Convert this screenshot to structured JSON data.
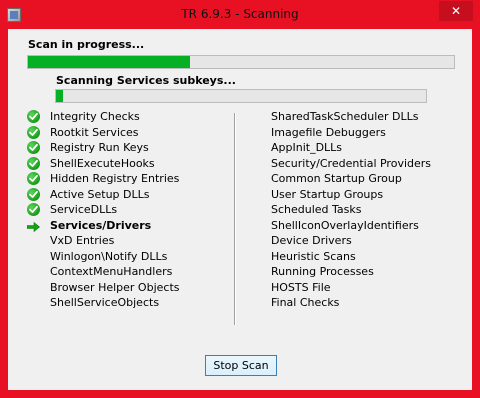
{
  "window": {
    "title": "TR 6.9.3 - Scanning",
    "close_label": "✕",
    "accent_color": "#e81123"
  },
  "scan": {
    "status_main": "Scan in progress...",
    "progress_main": 0.38,
    "status_sub": "Scanning Services subkeys...",
    "progress_sub": 0.02
  },
  "left_items": [
    {
      "label": "Integrity Checks",
      "state": "done"
    },
    {
      "label": "Rootkit Services",
      "state": "done"
    },
    {
      "label": "Registry Run Keys",
      "state": "done"
    },
    {
      "label": "ShellExecuteHooks",
      "state": "done"
    },
    {
      "label": "Hidden Registry Entries",
      "state": "done"
    },
    {
      "label": "Active Setup DLLs",
      "state": "done"
    },
    {
      "label": "ServiceDLLs",
      "state": "done"
    },
    {
      "label": "Services/Drivers",
      "state": "current"
    },
    {
      "label": "VxD Entries",
      "state": "pending"
    },
    {
      "label": "Winlogon\\Notify DLLs",
      "state": "pending"
    },
    {
      "label": "ContextMenuHandlers",
      "state": "pending"
    },
    {
      "label": "Browser Helper Objects",
      "state": "pending"
    },
    {
      "label": "ShellServiceObjects",
      "state": "pending"
    }
  ],
  "right_items": [
    {
      "label": "SharedTaskScheduler DLLs",
      "state": "pending"
    },
    {
      "label": "Imagefile Debuggers",
      "state": "pending"
    },
    {
      "label": "AppInit_DLLs",
      "state": "pending"
    },
    {
      "label": "Security/Credential Providers",
      "state": "pending"
    },
    {
      "label": "Common Startup Group",
      "state": "pending"
    },
    {
      "label": "User Startup Groups",
      "state": "pending"
    },
    {
      "label": "Scheduled Tasks",
      "state": "pending"
    },
    {
      "label": "ShellIconOverlayIdentifiers",
      "state": "pending"
    },
    {
      "label": "Device Drivers",
      "state": "pending"
    },
    {
      "label": "Heuristic Scans",
      "state": "pending"
    },
    {
      "label": "Running Processes",
      "state": "pending"
    },
    {
      "label": "HOSTS File",
      "state": "pending"
    },
    {
      "label": "Final Checks",
      "state": "pending"
    }
  ],
  "icons": {
    "done": "check-circle-icon",
    "current": "green-arrow-icon"
  },
  "buttons": {
    "stop_label": "Stop Scan"
  }
}
